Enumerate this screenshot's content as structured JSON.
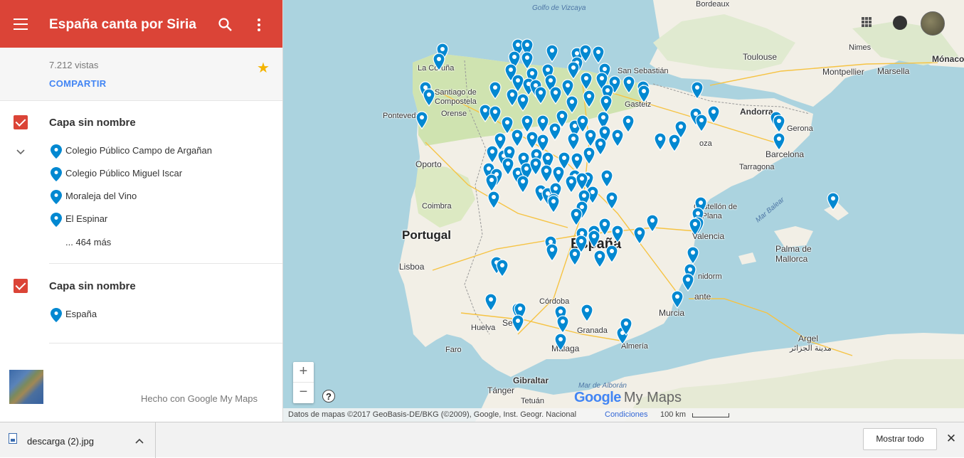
{
  "header": {
    "title": "España canta por Siria"
  },
  "info": {
    "views": "7.212 vistas",
    "share_label": "COMPARTIR"
  },
  "layers": [
    {
      "title": "Capa sin nombre",
      "checked": true,
      "places": [
        "Colegio Público Campo de Argañan",
        "Colegio Público Miguel Iscar",
        "Moraleja del Vino",
        "El Espinar"
      ],
      "more": "... 464 más"
    },
    {
      "title": "Capa sin nombre",
      "checked": true,
      "places": [
        "España"
      ]
    }
  ],
  "footer": {
    "made_with": "Hecho con Google My Maps"
  },
  "map": {
    "labels": {
      "vizcaya": "Golfo de Vizcaya",
      "bordeaux": "Bordeaux",
      "toulouse": "Toulouse",
      "nimes": "Nimes",
      "montpellier": "Montpellier",
      "marseille": "Marsella",
      "monaco": "Mónaco",
      "coruna": "La Coruña",
      "santiago": "Santiago de Compostela",
      "sansebastian": "San Sebastián",
      "pontevedra": "Pontevedra",
      "orense": "Orense",
      "gasteiz": "Gasteiz",
      "andorra": "Andorra",
      "gerona": "Gerona",
      "zaragoza": "oza",
      "barcelona": "Barcelona",
      "tarragona": "Tarragona",
      "oporto": "Oporto",
      "coimbra": "Coimbra",
      "portugal": "Portugal",
      "castellon": "Castellón de la Plana",
      "marbalear": "Mar Balear",
      "espana": "España",
      "valencia": "Valencia",
      "palma": "Palma de Mallorca",
      "lisboa": "Lisboa",
      "benidorm": "nidorm",
      "alicante": "ante",
      "cordoba": "Córdoba",
      "murcia": "Murcia",
      "huelva": "Huelva",
      "sevilla": "Se",
      "granada": "Granada",
      "almeria": "Almería",
      "faro": "Faro",
      "malaga": "Málaga",
      "argel": "Argel",
      "argel_ar": "مدينة الجزائر",
      "gibraltar": "Gibraltar",
      "alboran": "Mar de Alborán",
      "tanger": "Tánger",
      "tetuan": "Tetuán"
    },
    "zoom_in": "+",
    "zoom_out": "−",
    "help": "?",
    "logo_google": "Google",
    "logo_mymaps": "My Maps",
    "attribution": "Datos de mapas ©2017 GeoBasis-DE/BKG (©2009), Google, Inst. Geogr. Nacional",
    "terms": "Condiciones",
    "scale": "100 km",
    "marker_color": "#0288d1"
  },
  "download_bar": {
    "filename": "descarga (2).jpg",
    "show_all": "Mostrar todo",
    "close": "✕"
  },
  "colors": {
    "header_red": "#db4437",
    "link_blue": "#4285f4",
    "star": "#f4b400",
    "water": "#abd3df",
    "land": "#f2efe6",
    "green_land": "#cfe3b0"
  }
}
